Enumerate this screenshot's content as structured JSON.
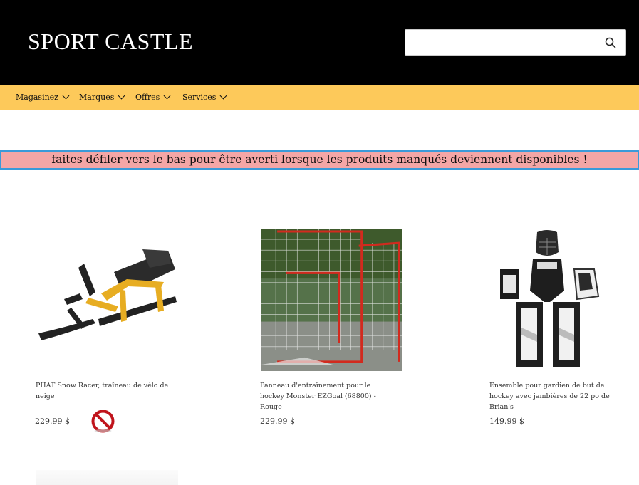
{
  "header": {
    "logo": "SPORT CASTLE",
    "search_placeholder": "",
    "search_icon": "search-icon"
  },
  "nav": {
    "items": [
      {
        "label": "Magasinez"
      },
      {
        "label": "Marques"
      },
      {
        "label": "Offres"
      },
      {
        "label": "Services"
      }
    ]
  },
  "banner": {
    "text": "faites défiler vers le bas pour être averti lorsque les produits manqués deviennent disponibles !"
  },
  "products": [
    {
      "name": "PHAT Snow Racer, traîneau de vélo de neige",
      "price": "229.99 $",
      "status_icon": "no-entry-icon"
    },
    {
      "name": "Panneau d'entraînement pour le hockey Monster EZGoal (68800) - Rouge",
      "price": "229.99 $"
    },
    {
      "name": "Ensemble pour gardien de but de hockey avec jambières de 22 po de Brian's",
      "price": "149.99 $"
    }
  ],
  "colors": {
    "header_bg": "#000000",
    "nav_bg": "#fdc95a",
    "banner_bg": "#f4a6a6",
    "banner_border": "#3a9ad9"
  }
}
